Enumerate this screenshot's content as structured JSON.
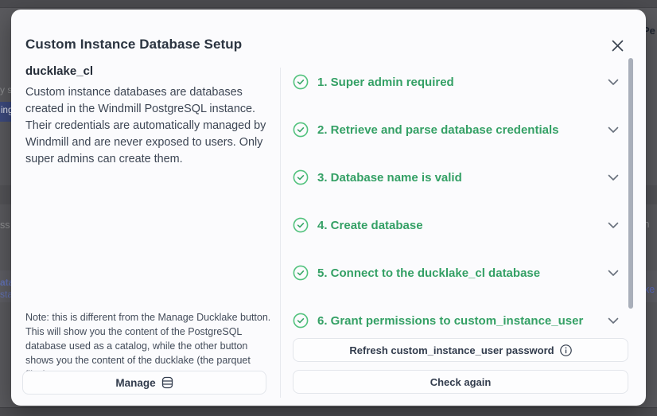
{
  "background": {
    "fragments": {
      "top_right": "Pe",
      "left_upper": "y s",
      "nav_selected": "ing",
      "left_mid": "ss",
      "right_mid": "s in",
      "left_link_bold": "ata",
      "left_link": "sta",
      "right_link": "ake"
    }
  },
  "modal": {
    "title": "Custom Instance Database Setup",
    "left": {
      "db_name": "ducklake_cl",
      "description": "Custom instance databases are databases created in the Windmill PostgreSQL instance. Their credentials are automatically managed by Windmill and are never exposed to users. Only super admins can create them.",
      "note": "Note: this is different from the Manage Ducklake button. This will show you the content of the PostgreSQL database used as a catalog, while the other button shows you the content of the ducklake (the parquet files).",
      "manage_label": "Manage"
    },
    "steps": [
      {
        "label": "1. Super admin required",
        "status": "success"
      },
      {
        "label": "2. Retrieve and parse database credentials",
        "status": "success"
      },
      {
        "label": "3. Database name is valid",
        "status": "success"
      },
      {
        "label": "4. Create database",
        "status": "success"
      },
      {
        "label": "5. Connect to the ducklake_cl database",
        "status": "success"
      },
      {
        "label": "6. Grant permissions to custom_instance_user",
        "status": "success"
      }
    ],
    "actions": {
      "refresh_label": "Refresh custom_instance_user password",
      "check_label": "Check again"
    },
    "colors": {
      "step_text_green": "#34a065",
      "step_icon_green": "#52c27d",
      "accent_nav_blue": "#3c4a7e"
    }
  }
}
